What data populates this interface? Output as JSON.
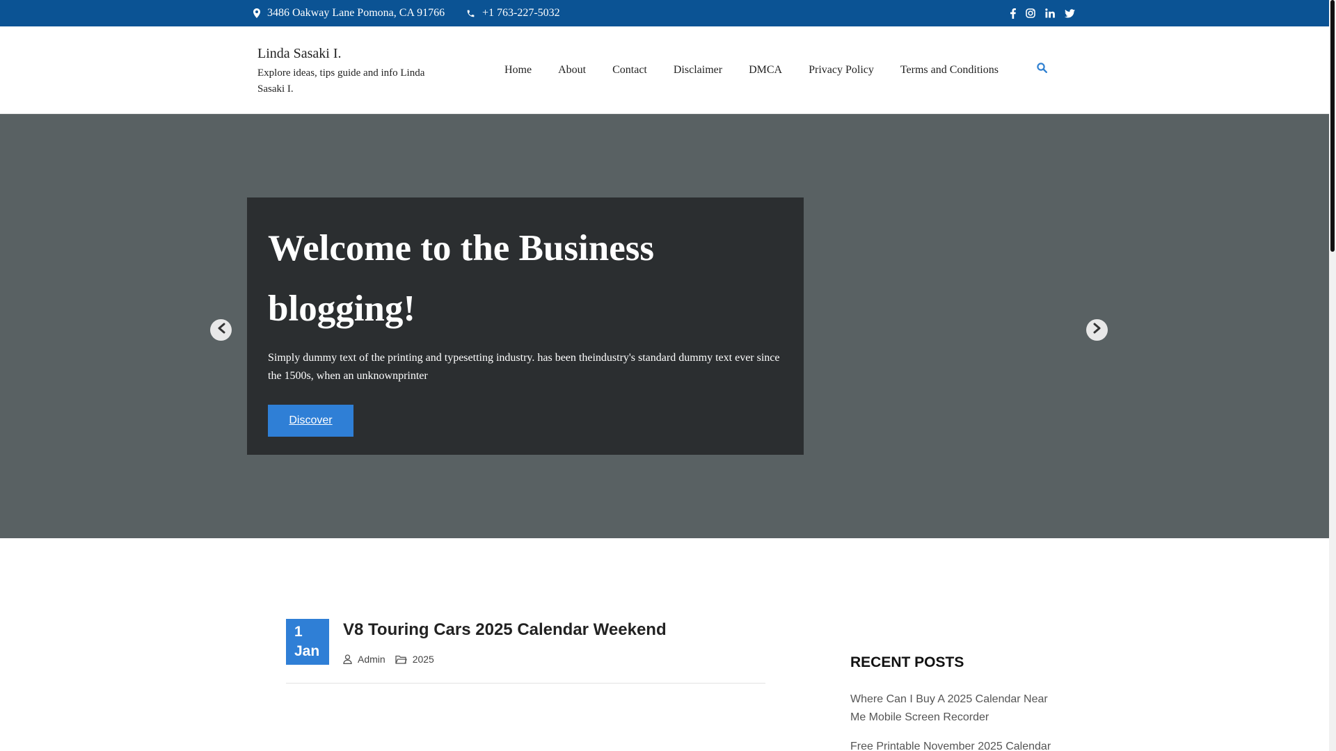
{
  "topbar": {
    "address": "3486 Oakway Lane Pomona, CA 91766",
    "phone": "+1 763-227-5032",
    "social_icons": [
      "facebook-icon",
      "instagram-icon",
      "linkedin-icon",
      "twitter-icon"
    ],
    "background": "#0b5394"
  },
  "header": {
    "site_title": "Linda Sasaki I.",
    "site_description": "Explore ideas, tips guide and info Linda Sasaki I.",
    "nav": [
      {
        "label": "Home"
      },
      {
        "label": "About"
      },
      {
        "label": "Contact"
      },
      {
        "label": "Disclaimer"
      },
      {
        "label": "DMCA"
      },
      {
        "label": "Privacy Policy"
      },
      {
        "label": "Terms and Conditions"
      }
    ],
    "search_icon": "search-icon"
  },
  "hero": {
    "title": "Welcome to the Business blogging!",
    "text": "Simply dummy text of the printing and typesetting industry. has been theindustry's standard dummy text ever since the 1500s, when an unknownprinter",
    "button_label": "Discover",
    "accent": "#2f7fd6"
  },
  "post": {
    "date_day": "1",
    "date_month": "Jan",
    "title": "V8 Touring Cars 2025 Calendar Weekend",
    "author": "Admin",
    "category": "2025"
  },
  "sidebar": {
    "title": "RECENT POSTS",
    "recent_posts": [
      "Where Can I Buy A 2025 Calendar Near Me Mobile Screen Recorder",
      "Free Printable November 2025 Calendar"
    ]
  }
}
